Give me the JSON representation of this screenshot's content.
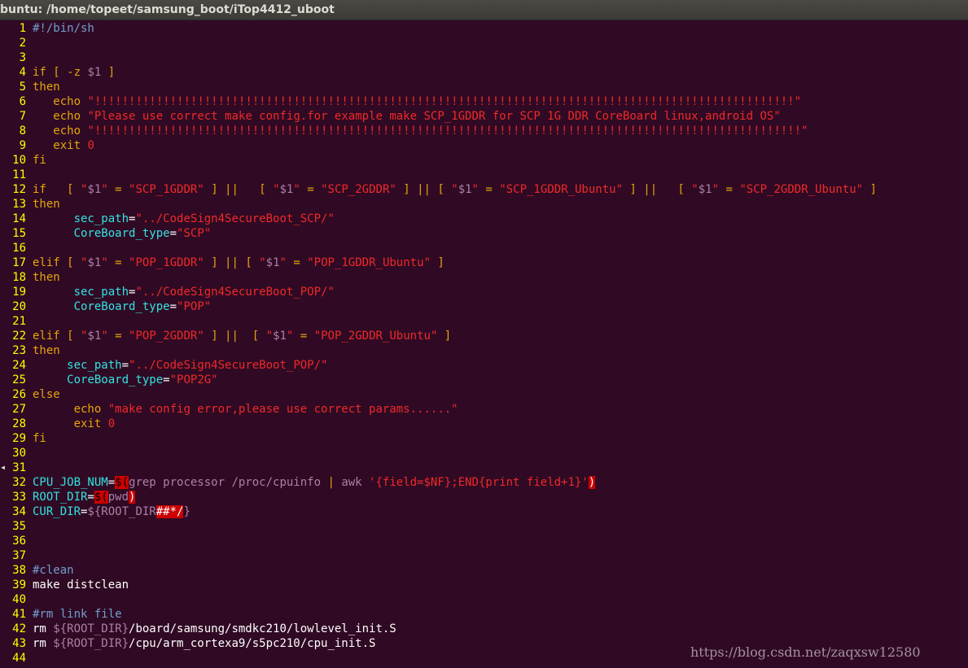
{
  "window": {
    "title": "buntu: /home/topeet/samsung_boot/iTop4412_uboot"
  },
  "colors": {
    "background": "#300a24",
    "line_number": "#ffff00",
    "keyword": "#e5a50a",
    "string": "#ef2929",
    "variable": "#ad7fa8",
    "identifier": "#34e2e2",
    "comment": "#729fcf",
    "error_highlight": "#cc0000"
  },
  "watermark": "https://blog.csdn.net/zaqxsw12580",
  "lines": [
    {
      "n": "1",
      "t": [
        [
          "cmt",
          "#!/bin/sh"
        ]
      ]
    },
    {
      "n": "2",
      "t": []
    },
    {
      "n": "3",
      "t": []
    },
    {
      "n": "4",
      "t": [
        [
          "kw",
          "if [ -z "
        ],
        [
          "var",
          "$1"
        ],
        [
          "kw",
          " ]"
        ]
      ]
    },
    {
      "n": "5",
      "t": [
        [
          "kw",
          "then"
        ]
      ]
    },
    {
      "n": "6",
      "t": [
        [
          "",
          "   "
        ],
        [
          "kw",
          "echo "
        ],
        [
          "str",
          "\"!!!!!!!!!!!!!!!!!!!!!!!!!!!!!!!!!!!!!!!!!!!!!!!!!!!!!!!!!!!!!!!!!!!!!!!!!!!!!!!!!!!!!!!!!!!!!!!!!!!!!!\""
        ]
      ]
    },
    {
      "n": "7",
      "t": [
        [
          "",
          "   "
        ],
        [
          "kw",
          "echo "
        ],
        [
          "str",
          "\"Please use correct make config.for example make SCP_1GDDR for SCP 1G DDR CoreBoard linux,android OS\""
        ]
      ]
    },
    {
      "n": "8",
      "t": [
        [
          "",
          "   "
        ],
        [
          "kw",
          "echo "
        ],
        [
          "str",
          "\"!!!!!!!!!!!!!!!!!!!!!!!!!!!!!!!!!!!!!!!!!!!!!!!!!!!!!!!!!!!!!!!!!!!!!!!!!!!!!!!!!!!!!!!!!!!!!!!!!!!!!!!\""
        ]
      ]
    },
    {
      "n": "9",
      "t": [
        [
          "",
          "   "
        ],
        [
          "kw",
          "exit "
        ],
        [
          "str",
          "0"
        ]
      ]
    },
    {
      "n": "10",
      "t": [
        [
          "kw",
          "fi"
        ]
      ]
    },
    {
      "n": "11",
      "t": []
    },
    {
      "n": "12",
      "t": [
        [
          "kw",
          "if   [ "
        ],
        [
          "str",
          "\""
        ],
        [
          "var",
          "$1"
        ],
        [
          "str",
          "\""
        ],
        [
          "kw",
          " = "
        ],
        [
          "str",
          "\"SCP_1GDDR\""
        ],
        [
          "kw",
          " ] ||   [ "
        ],
        [
          "str",
          "\""
        ],
        [
          "var",
          "$1"
        ],
        [
          "str",
          "\""
        ],
        [
          "kw",
          " = "
        ],
        [
          "str",
          "\"SCP_2GDDR\""
        ],
        [
          "kw",
          " ] || [ "
        ],
        [
          "str",
          "\""
        ],
        [
          "var",
          "$1"
        ],
        [
          "str",
          "\""
        ],
        [
          "kw",
          " = "
        ],
        [
          "str",
          "\"SCP_1GDDR_Ubuntu\""
        ],
        [
          "kw",
          " ] ||   [ "
        ],
        [
          "str",
          "\""
        ],
        [
          "var",
          "$1"
        ],
        [
          "str",
          "\""
        ],
        [
          "kw",
          " = "
        ],
        [
          "str",
          "\"SCP_2GDDR_Ubuntu\""
        ],
        [
          "kw",
          " ]"
        ]
      ]
    },
    {
      "n": "13",
      "t": [
        [
          "kw",
          "then"
        ]
      ]
    },
    {
      "n": "14",
      "t": [
        [
          "",
          "      "
        ],
        [
          "idf",
          "sec_path"
        ],
        [
          "",
          "="
        ],
        [
          "str",
          "\"../CodeSign4SecureBoot_SCP/\""
        ]
      ]
    },
    {
      "n": "15",
      "t": [
        [
          "",
          "      "
        ],
        [
          "idf",
          "CoreBoard_type"
        ],
        [
          "",
          "="
        ],
        [
          "str",
          "\"SCP\""
        ]
      ]
    },
    {
      "n": "16",
      "t": []
    },
    {
      "n": "17",
      "t": [
        [
          "kw",
          "elif [ "
        ],
        [
          "str",
          "\""
        ],
        [
          "var",
          "$1"
        ],
        [
          "str",
          "\""
        ],
        [
          "kw",
          " = "
        ],
        [
          "str",
          "\"POP_1GDDR\""
        ],
        [
          "kw",
          " ] || [ "
        ],
        [
          "str",
          "\""
        ],
        [
          "var",
          "$1"
        ],
        [
          "str",
          "\""
        ],
        [
          "kw",
          " = "
        ],
        [
          "str",
          "\"POP_1GDDR_Ubuntu\""
        ],
        [
          "kw",
          " ]"
        ]
      ]
    },
    {
      "n": "18",
      "t": [
        [
          "kw",
          "then"
        ]
      ]
    },
    {
      "n": "19",
      "t": [
        [
          "",
          "      "
        ],
        [
          "idf",
          "sec_path"
        ],
        [
          "",
          "="
        ],
        [
          "str",
          "\"../CodeSign4SecureBoot_POP/\""
        ]
      ]
    },
    {
      "n": "20",
      "t": [
        [
          "",
          "      "
        ],
        [
          "idf",
          "CoreBoard_type"
        ],
        [
          "",
          "="
        ],
        [
          "str",
          "\"POP\""
        ]
      ]
    },
    {
      "n": "21",
      "t": []
    },
    {
      "n": "22",
      "t": [
        [
          "kw",
          "elif [ "
        ],
        [
          "str",
          "\""
        ],
        [
          "var",
          "$1"
        ],
        [
          "str",
          "\""
        ],
        [
          "kw",
          " = "
        ],
        [
          "str",
          "\"POP_2GDDR\""
        ],
        [
          "kw",
          " ] ||  [ "
        ],
        [
          "str",
          "\""
        ],
        [
          "var",
          "$1"
        ],
        [
          "str",
          "\""
        ],
        [
          "kw",
          " = "
        ],
        [
          "str",
          "\"POP_2GDDR_Ubuntu\""
        ],
        [
          "kw",
          " ]"
        ]
      ]
    },
    {
      "n": "23",
      "t": [
        [
          "kw",
          "then"
        ]
      ]
    },
    {
      "n": "24",
      "t": [
        [
          "",
          "     "
        ],
        [
          "idf",
          "sec_path"
        ],
        [
          "",
          "="
        ],
        [
          "str",
          "\"../CodeSign4SecureBoot_POP/\""
        ]
      ]
    },
    {
      "n": "25",
      "t": [
        [
          "",
          "     "
        ],
        [
          "idf",
          "CoreBoard_type"
        ],
        [
          "",
          "="
        ],
        [
          "str",
          "\"POP2G\""
        ]
      ]
    },
    {
      "n": "26",
      "t": [
        [
          "kw",
          "else"
        ]
      ]
    },
    {
      "n": "27",
      "t": [
        [
          "",
          "      "
        ],
        [
          "kw",
          "echo "
        ],
        [
          "str",
          "\"make config error,please use correct params......\""
        ]
      ]
    },
    {
      "n": "28",
      "t": [
        [
          "",
          "      "
        ],
        [
          "kw",
          "exit "
        ],
        [
          "str",
          "0"
        ]
      ]
    },
    {
      "n": "29",
      "t": [
        [
          "kw",
          "fi"
        ]
      ]
    },
    {
      "n": "30",
      "t": []
    },
    {
      "n": "31",
      "t": []
    },
    {
      "n": "32",
      "t": [
        [
          "idf",
          "CPU_JOB_NUM"
        ],
        [
          "",
          "="
        ],
        [
          "hlk",
          "$("
        ],
        [
          "var",
          "grep processor /proc/cpuinfo "
        ],
        [
          "kw",
          "|"
        ],
        [
          "var",
          " awk "
        ],
        [
          "str",
          "'{field=$NF};END{print field+1}'"
        ],
        [
          "hl",
          ")"
        ]
      ]
    },
    {
      "n": "33",
      "t": [
        [
          "idf",
          "ROOT_DIR"
        ],
        [
          "",
          "="
        ],
        [
          "hlk",
          "$("
        ],
        [
          "var",
          "pwd"
        ],
        [
          "hl",
          ")"
        ]
      ]
    },
    {
      "n": "34",
      "t": [
        [
          "idf",
          "CUR_DIR"
        ],
        [
          "",
          "="
        ],
        [
          "var",
          "${ROOT_DIR"
        ],
        [
          "hl",
          "##*/"
        ],
        [
          "var",
          "}"
        ]
      ]
    },
    {
      "n": "35",
      "t": []
    },
    {
      "n": "36",
      "t": []
    },
    {
      "n": "37",
      "t": []
    },
    {
      "n": "38",
      "t": [
        [
          "cmt",
          "#clean"
        ]
      ]
    },
    {
      "n": "39",
      "t": [
        [
          "",
          "make distclean"
        ]
      ]
    },
    {
      "n": "40",
      "t": []
    },
    {
      "n": "41",
      "t": [
        [
          "cmt",
          "#rm link file"
        ]
      ]
    },
    {
      "n": "42",
      "t": [
        [
          "",
          "rm "
        ],
        [
          "var",
          "${ROOT_DIR}"
        ],
        [
          "",
          "/board/samsung/smdkc210/lowlevel_init.S"
        ]
      ]
    },
    {
      "n": "43",
      "t": [
        [
          "",
          "rm "
        ],
        [
          "var",
          "${ROOT_DIR}"
        ],
        [
          "",
          "/cpu/arm_cortexa9/s5pc210/cpu_init.S"
        ]
      ]
    },
    {
      "n": "44",
      "t": []
    }
  ]
}
